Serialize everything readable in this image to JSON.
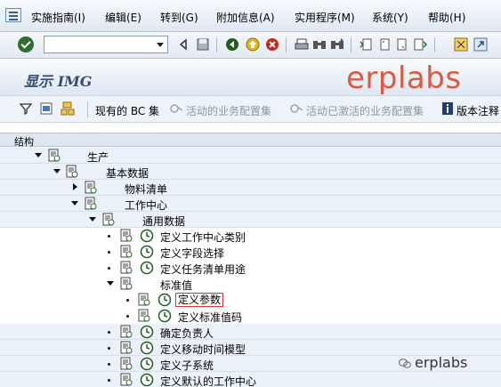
{
  "menubar": {
    "items": [
      "实施指南(I)",
      "编辑(E)",
      "转到(G)",
      "附加信息(A)",
      "实用程序(M)",
      "系统(Y)",
      "帮助(H)"
    ]
  },
  "toolbar": {
    "command_value": "",
    "icons": [
      "enter-icon",
      "back-icon",
      "save-icon",
      "back-green-icon",
      "exit-icon",
      "cancel-icon",
      "print-icon",
      "find-icon",
      "find-next-icon",
      "first-page-icon",
      "prev-page-icon",
      "next-page-icon",
      "last-page-icon",
      "create-session-icon",
      "shortcut-icon"
    ]
  },
  "title": {
    "text": "显示 IMG",
    "watermark": "erplabs"
  },
  "app_toolbar": {
    "buttons": [
      "现有的 BC 集",
      "活动的业务配置集",
      "活动已激活的业务配置集",
      "版本注释"
    ]
  },
  "tree": {
    "header": "结构",
    "rows": [
      {
        "label": "生产",
        "toggle": "open",
        "kind": "doc"
      },
      {
        "label": "基本数据",
        "toggle": "open",
        "kind": "doc"
      },
      {
        "label": "物料清单",
        "toggle": "closed",
        "kind": "doc"
      },
      {
        "label": "工作中心",
        "toggle": "open",
        "kind": "doc"
      },
      {
        "label": "通用数据",
        "toggle": "open",
        "kind": "doc"
      },
      {
        "label": "定义工作中心类别",
        "toggle": "bullet",
        "kind": "activity"
      },
      {
        "label": "定义字段选择",
        "toggle": "bullet",
        "kind": "activity"
      },
      {
        "label": "定义任务清单用途",
        "toggle": "bullet",
        "kind": "activity"
      },
      {
        "label": "标准值",
        "toggle": "open",
        "kind": "doc"
      },
      {
        "label": "定义参数",
        "toggle": "bullet",
        "kind": "activity",
        "selected": true
      },
      {
        "label": "定义标准值码",
        "toggle": "bullet",
        "kind": "activity"
      },
      {
        "label": "确定负责人",
        "toggle": "bullet",
        "kind": "activity"
      },
      {
        "label": "定义移动时间模型",
        "toggle": "bullet",
        "kind": "activity"
      },
      {
        "label": "定义子系统",
        "toggle": "bullet",
        "kind": "activity"
      },
      {
        "label": "定义默认的工作中心",
        "toggle": "bullet",
        "kind": "activity"
      }
    ]
  },
  "watermark_bottom": "erplabs"
}
